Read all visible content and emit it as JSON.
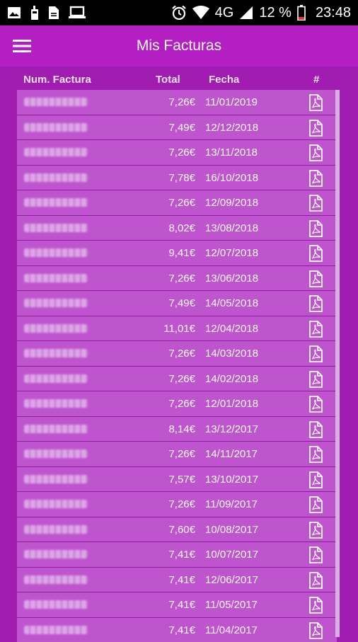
{
  "statusbar": {
    "network": "4G",
    "battery": "12 %",
    "time": "23:48"
  },
  "appbar": {
    "title": "Mis Facturas",
    "menu_icon": "hamburger-menu-icon"
  },
  "columns": {
    "num": "Num. Factura",
    "total": "Total",
    "fecha": "Fecha",
    "hash": "#"
  },
  "invoices": [
    {
      "total": "7,26€",
      "fecha": "11/01/2019"
    },
    {
      "total": "7,49€",
      "fecha": "12/12/2018"
    },
    {
      "total": "7,26€",
      "fecha": "13/11/2018"
    },
    {
      "total": "7,78€",
      "fecha": "16/10/2018"
    },
    {
      "total": "7,26€",
      "fecha": "12/09/2018"
    },
    {
      "total": "8,02€",
      "fecha": "13/08/2018"
    },
    {
      "total": "9,41€",
      "fecha": "12/07/2018"
    },
    {
      "total": "7,26€",
      "fecha": "13/06/2018"
    },
    {
      "total": "7,49€",
      "fecha": "14/05/2018"
    },
    {
      "total": "11,01€",
      "fecha": "12/04/2018"
    },
    {
      "total": "7,26€",
      "fecha": "14/03/2018"
    },
    {
      "total": "7,26€",
      "fecha": "14/02/2018"
    },
    {
      "total": "7,26€",
      "fecha": "12/01/2018"
    },
    {
      "total": "8,14€",
      "fecha": "13/12/2017"
    },
    {
      "total": "7,26€",
      "fecha": "14/11/2017"
    },
    {
      "total": "7,57€",
      "fecha": "13/10/2017"
    },
    {
      "total": "7,26€",
      "fecha": "11/09/2017"
    },
    {
      "total": "7,60€",
      "fecha": "10/08/2017"
    },
    {
      "total": "7,41€",
      "fecha": "10/07/2017"
    },
    {
      "total": "7,41€",
      "fecha": "12/06/2017"
    },
    {
      "total": "7,41€",
      "fecha": "11/05/2017"
    },
    {
      "total": "7,41€",
      "fecha": "11/04/2017"
    }
  ],
  "colors": {
    "background": "#a11cb0",
    "appbar": "#b31fc2",
    "row": "#bf54cf",
    "row_divider": "#8e1a9c"
  }
}
